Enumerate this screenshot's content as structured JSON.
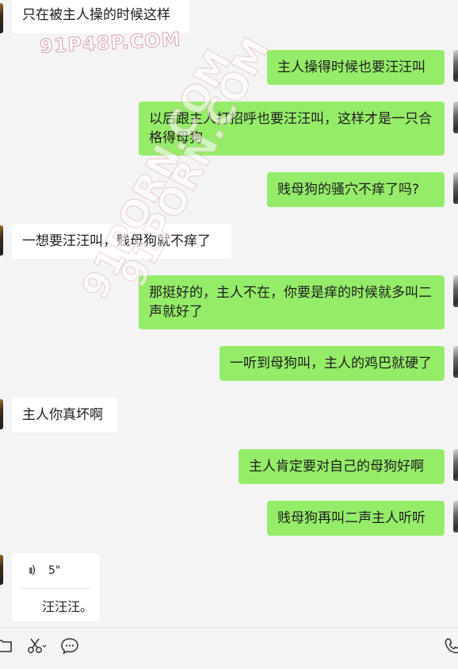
{
  "watermark": "91P48P.COM",
  "watermark_diag": "91PORN.COM",
  "messages": [
    {
      "side": "in",
      "text": "只在被主人操的时候这样"
    },
    {
      "side": "out",
      "text": "主人操得时候也要汪汪叫"
    },
    {
      "side": "out",
      "text": "以后跟主人打招呼也要汪汪叫，这样才是一只合格得母狗"
    },
    {
      "side": "out",
      "text": "贱母狗的骚穴不痒了吗?"
    },
    {
      "side": "in",
      "text": "一想要汪汪叫，贱母狗就不痒了"
    },
    {
      "side": "out",
      "text": "那挺好的，主人不在，你要是痒的时候就多叫二声就好了"
    },
    {
      "side": "out",
      "text": "一听到母狗叫，主人的鸡巴就硬了"
    },
    {
      "side": "in",
      "text": "主人你真坏啊"
    },
    {
      "side": "out",
      "text": "主人肯定要对自己的母狗好啊"
    },
    {
      "side": "out",
      "text": "贱母狗再叫二声主人听听"
    }
  ],
  "voice_message": {
    "side": "in",
    "wave_icon": "voice-wave-icon",
    "duration": "5\"",
    "transcript": "汪汪汪。"
  },
  "toolbar": {
    "icons": [
      "folder-icon",
      "scissors-icon",
      "chat-bubble-icon",
      "phone-icon"
    ]
  }
}
